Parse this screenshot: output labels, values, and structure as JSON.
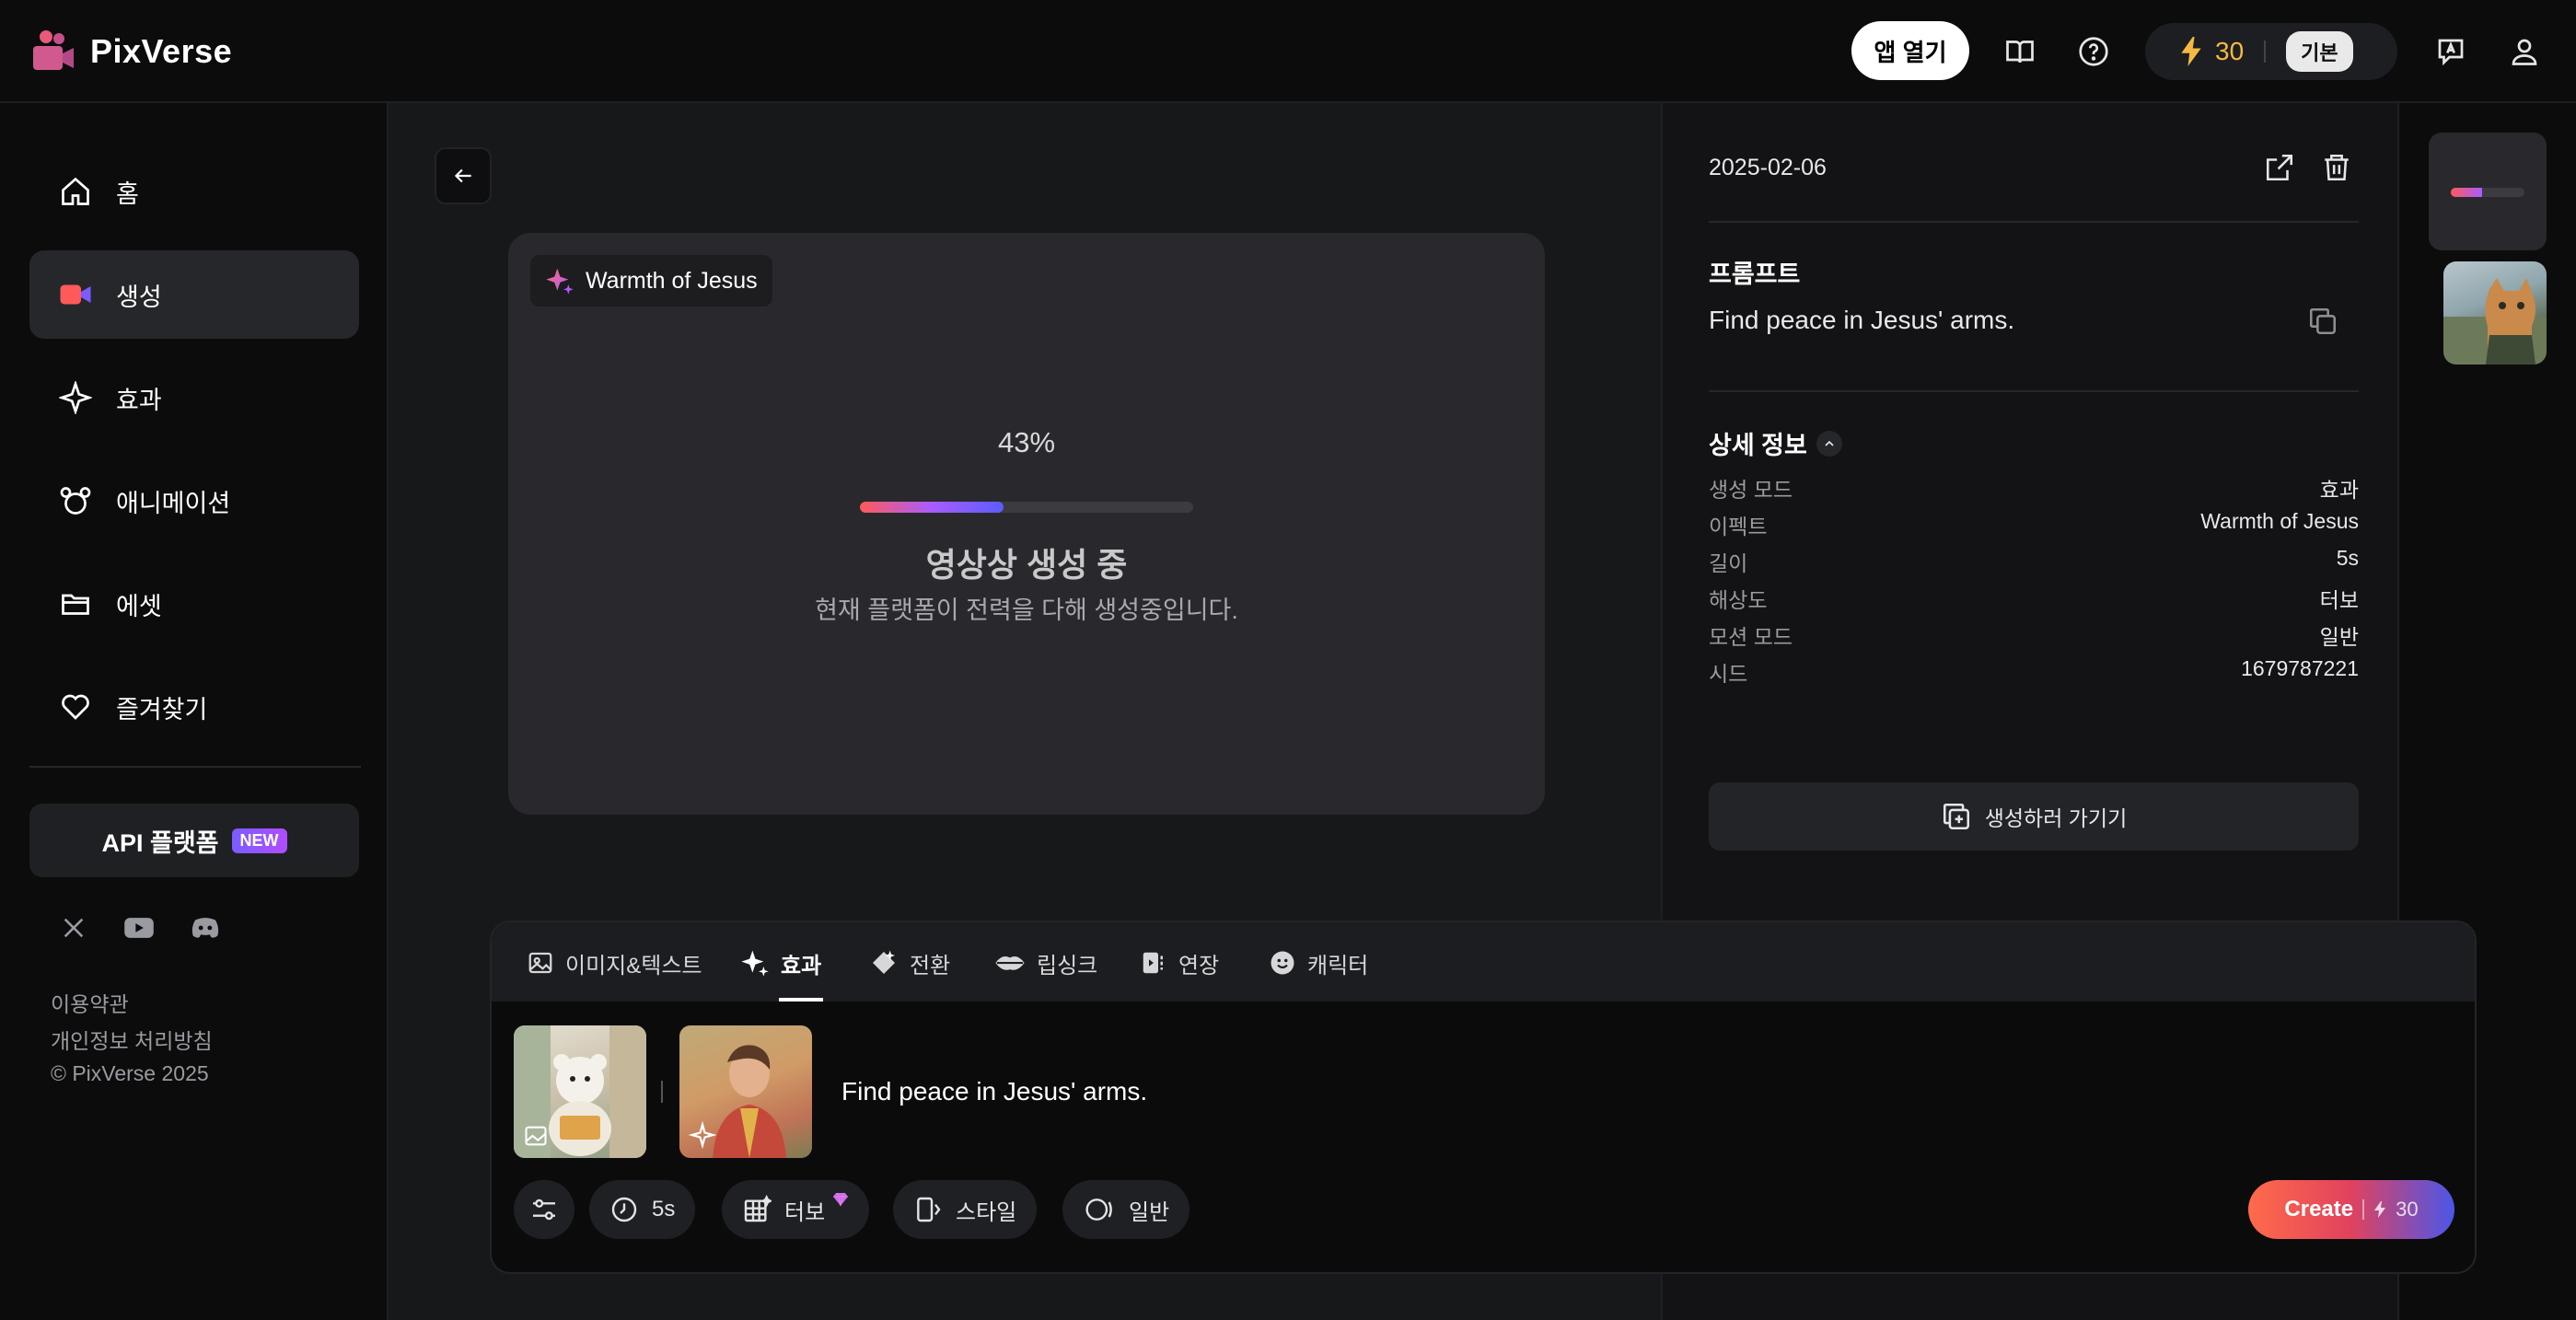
{
  "app": {
    "name": "PixVerse"
  },
  "header": {
    "open_app_label": "앱 열기",
    "credits": "30",
    "plan": "기본"
  },
  "sidebar": {
    "items": [
      {
        "label": "홈",
        "icon": "home-icon"
      },
      {
        "label": "생성",
        "icon": "camera-icon"
      },
      {
        "label": "효과",
        "icon": "sparkle-icon"
      },
      {
        "label": "애니메이션",
        "icon": "mouse-icon"
      },
      {
        "label": "에셋",
        "icon": "folder-icon"
      },
      {
        "label": "즐겨찾기",
        "icon": "heart-icon"
      }
    ],
    "api_label": "API 플랫폼",
    "api_badge": "NEW",
    "footer": {
      "terms": "이용약관",
      "privacy": "개인정보 처리방침",
      "copyright": "© PixVerse 2025"
    }
  },
  "generation": {
    "effect_tag": "Warmth of Jesus",
    "progress_label": "43%",
    "progress_fraction": 0.43,
    "title": "영상상 생성 중",
    "subtitle": "현재 플랫폼이 전력을 다해 생성중입니다."
  },
  "detail": {
    "date": "2025-02-06",
    "prompt_title": "프롬프트",
    "prompt": "Find peace in Jesus' arms.",
    "info_title": "상세 정보",
    "rows": [
      {
        "key": "생성 모드",
        "value": "효과"
      },
      {
        "key": "이펙트",
        "value": "Warmth of Jesus"
      },
      {
        "key": "길이",
        "value": "5s"
      },
      {
        "key": "해상도",
        "value": "터보"
      },
      {
        "key": "모션 모드",
        "value": "일반"
      },
      {
        "key": "시드",
        "value": "1679787221"
      }
    ],
    "goto_create_label": "생성하러 가기기"
  },
  "composer": {
    "tabs": [
      {
        "label": "이미지&텍스트"
      },
      {
        "label": "효과"
      },
      {
        "label": "전환"
      },
      {
        "label": "립싱크"
      },
      {
        "label": "연장"
      },
      {
        "label": "캐릭터"
      }
    ],
    "prompt": "Find peace in Jesus' arms.",
    "options": {
      "duration": "5s",
      "quality": "터보",
      "style": "스타일",
      "motion": "일반"
    },
    "create_label": "Create",
    "create_cost": "30"
  },
  "colors": {
    "accent_gradient_start": "#ff6b4a",
    "accent_gradient_end": "#4a57e8",
    "credits": "#f5b942"
  }
}
